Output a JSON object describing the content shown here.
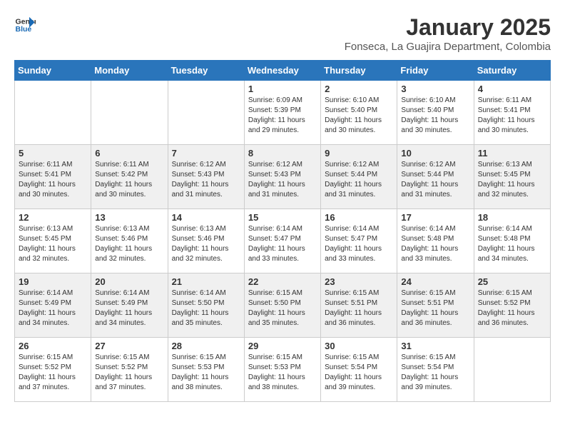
{
  "header": {
    "logo_general": "General",
    "logo_blue": "Blue",
    "title": "January 2025",
    "location": "Fonseca, La Guajira Department, Colombia"
  },
  "calendar": {
    "days_of_week": [
      "Sunday",
      "Monday",
      "Tuesday",
      "Wednesday",
      "Thursday",
      "Friday",
      "Saturday"
    ],
    "weeks": [
      [
        {
          "day": "",
          "info": ""
        },
        {
          "day": "",
          "info": ""
        },
        {
          "day": "",
          "info": ""
        },
        {
          "day": "1",
          "info": "Sunrise: 6:09 AM\nSunset: 5:39 PM\nDaylight: 11 hours and 29 minutes."
        },
        {
          "day": "2",
          "info": "Sunrise: 6:10 AM\nSunset: 5:40 PM\nDaylight: 11 hours and 30 minutes."
        },
        {
          "day": "3",
          "info": "Sunrise: 6:10 AM\nSunset: 5:40 PM\nDaylight: 11 hours and 30 minutes."
        },
        {
          "day": "4",
          "info": "Sunrise: 6:11 AM\nSunset: 5:41 PM\nDaylight: 11 hours and 30 minutes."
        }
      ],
      [
        {
          "day": "5",
          "info": "Sunrise: 6:11 AM\nSunset: 5:41 PM\nDaylight: 11 hours and 30 minutes."
        },
        {
          "day": "6",
          "info": "Sunrise: 6:11 AM\nSunset: 5:42 PM\nDaylight: 11 hours and 30 minutes."
        },
        {
          "day": "7",
          "info": "Sunrise: 6:12 AM\nSunset: 5:43 PM\nDaylight: 11 hours and 31 minutes."
        },
        {
          "day": "8",
          "info": "Sunrise: 6:12 AM\nSunset: 5:43 PM\nDaylight: 11 hours and 31 minutes."
        },
        {
          "day": "9",
          "info": "Sunrise: 6:12 AM\nSunset: 5:44 PM\nDaylight: 11 hours and 31 minutes."
        },
        {
          "day": "10",
          "info": "Sunrise: 6:12 AM\nSunset: 5:44 PM\nDaylight: 11 hours and 31 minutes."
        },
        {
          "day": "11",
          "info": "Sunrise: 6:13 AM\nSunset: 5:45 PM\nDaylight: 11 hours and 32 minutes."
        }
      ],
      [
        {
          "day": "12",
          "info": "Sunrise: 6:13 AM\nSunset: 5:45 PM\nDaylight: 11 hours and 32 minutes."
        },
        {
          "day": "13",
          "info": "Sunrise: 6:13 AM\nSunset: 5:46 PM\nDaylight: 11 hours and 32 minutes."
        },
        {
          "day": "14",
          "info": "Sunrise: 6:13 AM\nSunset: 5:46 PM\nDaylight: 11 hours and 32 minutes."
        },
        {
          "day": "15",
          "info": "Sunrise: 6:14 AM\nSunset: 5:47 PM\nDaylight: 11 hours and 33 minutes."
        },
        {
          "day": "16",
          "info": "Sunrise: 6:14 AM\nSunset: 5:47 PM\nDaylight: 11 hours and 33 minutes."
        },
        {
          "day": "17",
          "info": "Sunrise: 6:14 AM\nSunset: 5:48 PM\nDaylight: 11 hours and 33 minutes."
        },
        {
          "day": "18",
          "info": "Sunrise: 6:14 AM\nSunset: 5:48 PM\nDaylight: 11 hours and 34 minutes."
        }
      ],
      [
        {
          "day": "19",
          "info": "Sunrise: 6:14 AM\nSunset: 5:49 PM\nDaylight: 11 hours and 34 minutes."
        },
        {
          "day": "20",
          "info": "Sunrise: 6:14 AM\nSunset: 5:49 PM\nDaylight: 11 hours and 34 minutes."
        },
        {
          "day": "21",
          "info": "Sunrise: 6:14 AM\nSunset: 5:50 PM\nDaylight: 11 hours and 35 minutes."
        },
        {
          "day": "22",
          "info": "Sunrise: 6:15 AM\nSunset: 5:50 PM\nDaylight: 11 hours and 35 minutes."
        },
        {
          "day": "23",
          "info": "Sunrise: 6:15 AM\nSunset: 5:51 PM\nDaylight: 11 hours and 36 minutes."
        },
        {
          "day": "24",
          "info": "Sunrise: 6:15 AM\nSunset: 5:51 PM\nDaylight: 11 hours and 36 minutes."
        },
        {
          "day": "25",
          "info": "Sunrise: 6:15 AM\nSunset: 5:52 PM\nDaylight: 11 hours and 36 minutes."
        }
      ],
      [
        {
          "day": "26",
          "info": "Sunrise: 6:15 AM\nSunset: 5:52 PM\nDaylight: 11 hours and 37 minutes."
        },
        {
          "day": "27",
          "info": "Sunrise: 6:15 AM\nSunset: 5:52 PM\nDaylight: 11 hours and 37 minutes."
        },
        {
          "day": "28",
          "info": "Sunrise: 6:15 AM\nSunset: 5:53 PM\nDaylight: 11 hours and 38 minutes."
        },
        {
          "day": "29",
          "info": "Sunrise: 6:15 AM\nSunset: 5:53 PM\nDaylight: 11 hours and 38 minutes."
        },
        {
          "day": "30",
          "info": "Sunrise: 6:15 AM\nSunset: 5:54 PM\nDaylight: 11 hours and 39 minutes."
        },
        {
          "day": "31",
          "info": "Sunrise: 6:15 AM\nSunset: 5:54 PM\nDaylight: 11 hours and 39 minutes."
        },
        {
          "day": "",
          "info": ""
        }
      ]
    ]
  }
}
